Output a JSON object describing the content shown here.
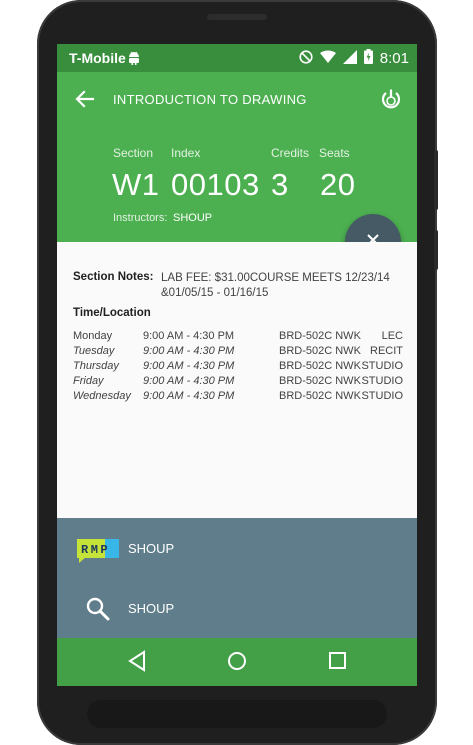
{
  "status_bar": {
    "carrier": "T-Mobile",
    "time": "8:01",
    "icons": [
      "android-icon",
      "do-not-disturb-icon",
      "wifi-icon",
      "signal-icon",
      "battery-charging-icon"
    ]
  },
  "header": {
    "title": "INTRODUCTION TO DRAWING",
    "back_icon": "arrow-back-icon",
    "action_icon": "power-icon",
    "fields": {
      "section": {
        "label": "Section",
        "value": "W1"
      },
      "index": {
        "label": "Index",
        "value": "00103"
      },
      "credits": {
        "label": "Credits",
        "value": "3"
      },
      "seats": {
        "label": "Seats",
        "value": "20"
      }
    },
    "instructors_label": "Instructors:",
    "instructors_value": "SHOUP"
  },
  "fab": {
    "icon": "close-icon"
  },
  "details": {
    "notes_label": "Section Notes:",
    "notes_text": "LAB FEE: $31.00COURSE MEETS 12/23/14 &01/05/15 - 01/16/15",
    "time_location_header": "Time/Location",
    "schedule": [
      {
        "day": "Monday",
        "time": "9:00 AM - 4:30 PM",
        "room": "BRD-502C NWK",
        "type": "LEC"
      },
      {
        "day": "Tuesday",
        "time": "9:00 AM - 4:30 PM",
        "room": "BRD-502C NWK",
        "type": "RECIT"
      },
      {
        "day": "Thursday",
        "time": "9:00 AM - 4:30 PM",
        "room": "BRD-502C NWK",
        "type": "STUDIO"
      },
      {
        "day": "Friday",
        "time": "9:00 AM - 4:30 PM",
        "room": "BRD-502C NWK",
        "type": "STUDIO"
      },
      {
        "day": "Wednesday",
        "time": "9:00 AM - 4:30 PM",
        "room": "BRD-502C NWK",
        "type": "STUDIO"
      }
    ]
  },
  "sheet": {
    "rmp_logo_text": "RMP",
    "rmp_label": "SHOUP",
    "search_label": "SHOUP"
  },
  "navbar": {
    "icons": [
      "nav-back-icon",
      "nav-home-icon",
      "nav-recents-icon"
    ]
  },
  "colors": {
    "status_bar": "#388e3c",
    "header": "#4caf50",
    "fab": "#455a64",
    "sheet": "#607d8b",
    "navbar": "#43a047"
  }
}
